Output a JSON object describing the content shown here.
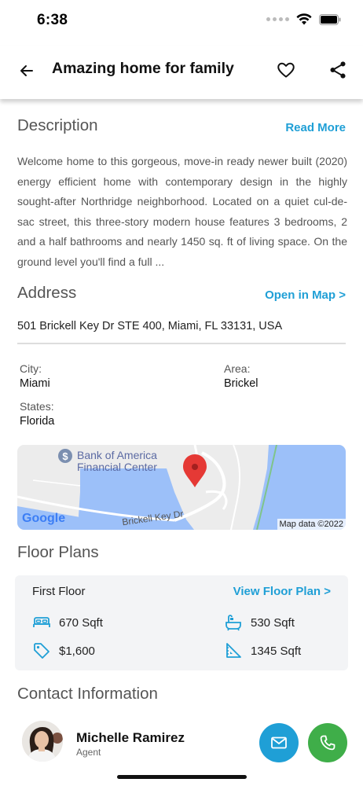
{
  "status_bar": {
    "time": "6:38"
  },
  "header": {
    "title": "Amazing home for family"
  },
  "description": {
    "heading": "Description",
    "read_more": "Read More",
    "text": "Welcome home to this gorgeous, move-in ready newer built (2020) energy efficient home with contemporary design in the highly sought-after Northridge neighborhood. Located on a quiet cul-de-sac street, this three-story modern house features 3 bedrooms, 2 and a half bathrooms and nearly 1450 sq. ft of living space. On the ground level you'll find a full ..."
  },
  "address": {
    "heading": "Address",
    "open_map": "Open in Map >",
    "line": "501 Brickell Key Dr STE 400, Miami, FL 33131, USA",
    "city_label": "City:",
    "city": "Miami",
    "area_label": "Area:",
    "area": "Brickel",
    "state_label": "States:",
    "state": "Florida"
  },
  "map": {
    "poi_line1": "Bank of America",
    "poi_line2": "Financial Center",
    "street": "Brickell Key Dr",
    "logo": "Google",
    "attribution": "Map data ©2022"
  },
  "floor_plans": {
    "heading": "Floor Plans",
    "floor_name": "First Floor",
    "view_link": "View Floor Plan >",
    "items": [
      {
        "icon": "bed-icon",
        "value": "670 Sqft"
      },
      {
        "icon": "bathtub-icon",
        "value": "530 Sqft"
      },
      {
        "icon": "price-tag-icon",
        "value": "$1,600"
      },
      {
        "icon": "area-ruler-icon",
        "value": "1345 Sqft"
      }
    ]
  },
  "contact": {
    "heading": "Contact Information",
    "name": "Michelle Ramirez",
    "role": "Agent"
  },
  "colors": {
    "accent": "#1f9fd6",
    "call": "#3fae49",
    "map_water": "#9cc0f9",
    "pin": "#e53935"
  }
}
